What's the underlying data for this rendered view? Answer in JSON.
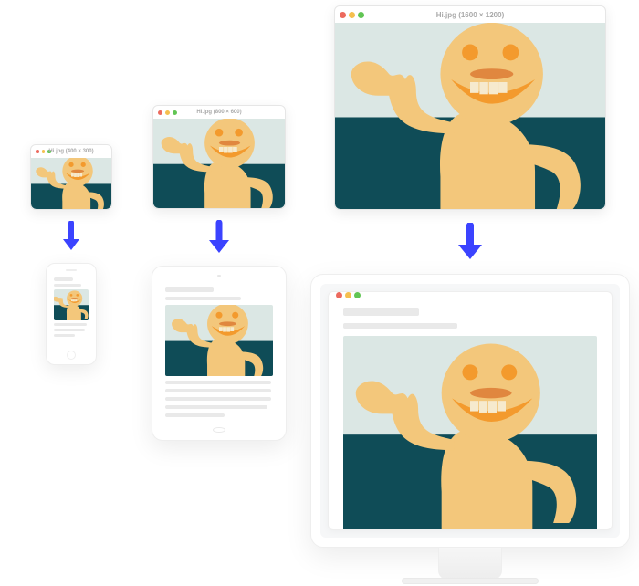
{
  "images": {
    "small": {
      "filename": "Hi.jpg",
      "dimensions": "(400 × 300)",
      "title": "Hi.jpg (400 × 300)"
    },
    "medium": {
      "filename": "Hi.jpg",
      "dimensions": "(800 × 600)",
      "title": "Hi.jpg (800 × 600)"
    },
    "large": {
      "filename": "Hi.jpg",
      "dimensions": "(1600 × 1200)",
      "title": "Hi.jpg (1600 × 1200)"
    }
  },
  "colors": {
    "sky": "#dbe7e4",
    "sea": "#0f4c57",
    "skin": "#f3c77b",
    "accent": "#f39a2d",
    "arrow": "#3b43ff"
  }
}
